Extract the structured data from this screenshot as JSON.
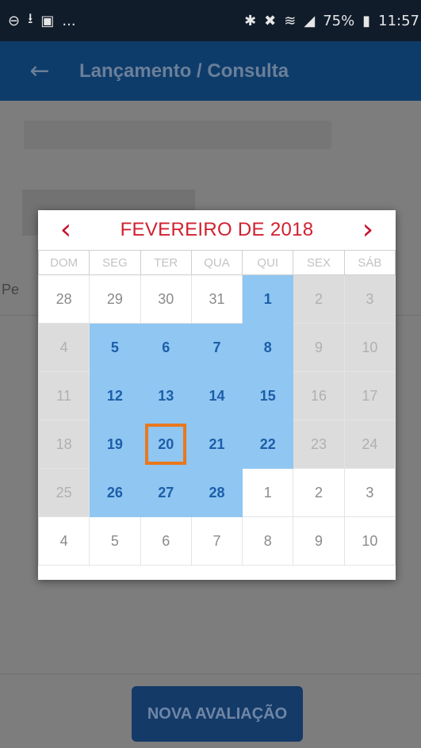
{
  "status_bar": {
    "left_icons": [
      "settings-circle-icon",
      "upload-icon",
      "image-icon",
      "more-notifications-icon"
    ],
    "more_label": "...",
    "right_icons": [
      "bluetooth-icon",
      "mute-icon",
      "wifi-icon",
      "signal-icon"
    ],
    "battery_percent": "75%",
    "time": "11:57"
  },
  "app_bar": {
    "title": "Lançamento / Consulta"
  },
  "background": {
    "partial_label": "Pe",
    "primary_button": "NOVA AVALIAÇÃO"
  },
  "calendar": {
    "title": "FEVEREIRO DE 2018",
    "prev_symbol": "‹",
    "next_symbol": "›",
    "weekdays": [
      "DOM",
      "SEG",
      "TER",
      "QUA",
      "QUI",
      "SEX",
      "SÁB"
    ],
    "weeks": [
      [
        {
          "d": "28",
          "s": "out"
        },
        {
          "d": "29",
          "s": "out"
        },
        {
          "d": "30",
          "s": "out"
        },
        {
          "d": "31",
          "s": "out"
        },
        {
          "d": "1",
          "s": "avail"
        },
        {
          "d": "2",
          "s": "off"
        },
        {
          "d": "3",
          "s": "off"
        }
      ],
      [
        {
          "d": "4",
          "s": "off"
        },
        {
          "d": "5",
          "s": "avail"
        },
        {
          "d": "6",
          "s": "avail"
        },
        {
          "d": "7",
          "s": "avail"
        },
        {
          "d": "8",
          "s": "avail"
        },
        {
          "d": "9",
          "s": "off"
        },
        {
          "d": "10",
          "s": "off"
        }
      ],
      [
        {
          "d": "11",
          "s": "off"
        },
        {
          "d": "12",
          "s": "avail"
        },
        {
          "d": "13",
          "s": "avail"
        },
        {
          "d": "14",
          "s": "avail"
        },
        {
          "d": "15",
          "s": "avail"
        },
        {
          "d": "16",
          "s": "off"
        },
        {
          "d": "17",
          "s": "off"
        }
      ],
      [
        {
          "d": "18",
          "s": "off"
        },
        {
          "d": "19",
          "s": "avail"
        },
        {
          "d": "20",
          "s": "avail",
          "selected": true
        },
        {
          "d": "21",
          "s": "avail"
        },
        {
          "d": "22",
          "s": "avail"
        },
        {
          "d": "23",
          "s": "off"
        },
        {
          "d": "24",
          "s": "off"
        }
      ],
      [
        {
          "d": "25",
          "s": "off"
        },
        {
          "d": "26",
          "s": "avail"
        },
        {
          "d": "27",
          "s": "avail"
        },
        {
          "d": "28",
          "s": "avail"
        },
        {
          "d": "1",
          "s": "out"
        },
        {
          "d": "2",
          "s": "out"
        },
        {
          "d": "3",
          "s": "out"
        }
      ],
      [
        {
          "d": "4",
          "s": "out"
        },
        {
          "d": "5",
          "s": "out"
        },
        {
          "d": "6",
          "s": "out"
        },
        {
          "d": "7",
          "s": "out"
        },
        {
          "d": "8",
          "s": "out"
        },
        {
          "d": "9",
          "s": "out"
        },
        {
          "d": "10",
          "s": "out"
        }
      ]
    ],
    "colors": {
      "title": "#d1202f",
      "available_bg": "#8fc6f2",
      "available_text": "#1c5ea8",
      "unavailable_bg": "#dcdcdc",
      "selection_outline": "#e9781e"
    }
  }
}
